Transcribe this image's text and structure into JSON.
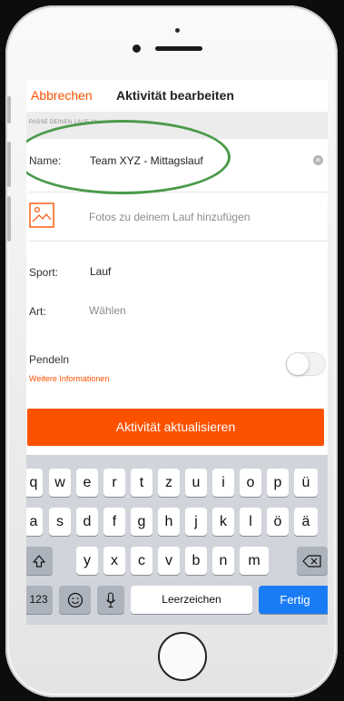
{
  "nav": {
    "cancel_label": "Abbrechen",
    "title": "Aktivität bearbeiten"
  },
  "section": {
    "label": "PASSE DEINEN LAUF AN"
  },
  "form": {
    "name_label": "Name:",
    "name_value": "Team XYZ - Mittagslauf",
    "photos_label": "Fotos zu deinem Lauf hinzufügen",
    "sport_label": "Sport:",
    "sport_value": "Lauf",
    "art_label": "Art:",
    "art_placeholder": "Wählen",
    "pendeln_label": "Pendeln",
    "pendeln_on": false,
    "more_info_link": "Weitere Informationen"
  },
  "update_button": "Aktivität aktualisieren",
  "keyboard": {
    "row1": [
      "q",
      "w",
      "e",
      "r",
      "t",
      "z",
      "u",
      "i",
      "o",
      "p",
      "ü"
    ],
    "row2": [
      "a",
      "s",
      "d",
      "f",
      "g",
      "h",
      "j",
      "k",
      "l",
      "ö",
      "ä"
    ],
    "row3": [
      "y",
      "x",
      "c",
      "v",
      "b",
      "n",
      "m"
    ],
    "numbers_label": "123",
    "space_label": "Leerzeichen",
    "done_label": "Fertig",
    "icons": {
      "shift": "shift-arrow-icon",
      "delete": "backspace-icon",
      "emoji": "emoji-icon",
      "mic": "microphone-icon"
    }
  },
  "colors": {
    "accent": "#fc5200",
    "annotation": "#4a9a4a",
    "done_key": "#1a7cf5"
  }
}
